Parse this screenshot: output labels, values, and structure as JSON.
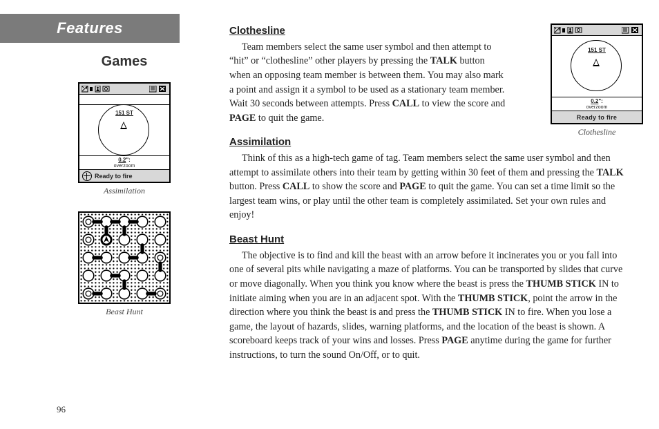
{
  "tab_label": "Features",
  "left_heading": "Games",
  "page_number": "96",
  "figures": {
    "assimilation": {
      "caption": "Assimilation",
      "dist_label": "151 ST",
      "zoom_value": "0.2",
      "zoom_text": "overzoom",
      "status": "Ready to fire"
    },
    "beasthunt": {
      "caption": "Beast Hunt"
    },
    "clothesline": {
      "caption": "Clothesline",
      "dist_label": "151 ST",
      "zoom_value": "0.2",
      "zoom_text": "overzoom",
      "status": "Ready to fire"
    }
  },
  "sections": {
    "clothesline": {
      "heading": "Clothesline",
      "t0": "Team members select the same user symbol and then attempt to “hit” or “clothesline” other players by pressing the ",
      "k0": "TALK",
      "t1": " button when an opposing team member is between them.  You may also mark a point and assign it a symbol to be used as a stationary team member.  Wait 30 seconds between attempts.  Press ",
      "k1": "CALL",
      "t2": " to view the score and ",
      "k2": "PAGE",
      "t3": " to quit the game."
    },
    "assimilation": {
      "heading": "Assimilation",
      "t0": "Think of this as a high-tech game of tag.  Team members select the same user symbol and then attempt to assimilate others into their team by getting within 30 feet of them and pressing the ",
      "k0": "TALK",
      "t1": " button.  Press ",
      "k1": "CALL",
      "t2": " to show the score and ",
      "k2": "PAGE",
      "t3": " to quit the game.  You can set a time limit so the largest team wins, or play until the other team is completely assimilated.  Set your own rules and enjoy!"
    },
    "beasthunt": {
      "heading": "Beast Hunt",
      "t0": "The objective is to find and kill the beast with an arrow before it incinerates you or you fall into one of several pits while navigating a maze of platforms.  You can be transported by slides that curve or move diagonally.  When you think you know where the beast is press the ",
      "k0": "THUMB STICK",
      "t1": " IN to initiate aiming when you are in an adjacent spot.  With the ",
      "k1": "THUMB STICK",
      "t2": ", point the arrow in the direction where you think the beast is and press the ",
      "k2": "THUMB STICK",
      "t3": " IN to fire.  When you lose a game, the layout of hazards, slides, warning platforms, and the location of the beast is shown.  A scoreboard keeps track of your wins and losses.  Press ",
      "k3": "PAGE",
      "t4": " anytime during the game for further instructions, to turn the sound On/Off, or to quit."
    }
  }
}
